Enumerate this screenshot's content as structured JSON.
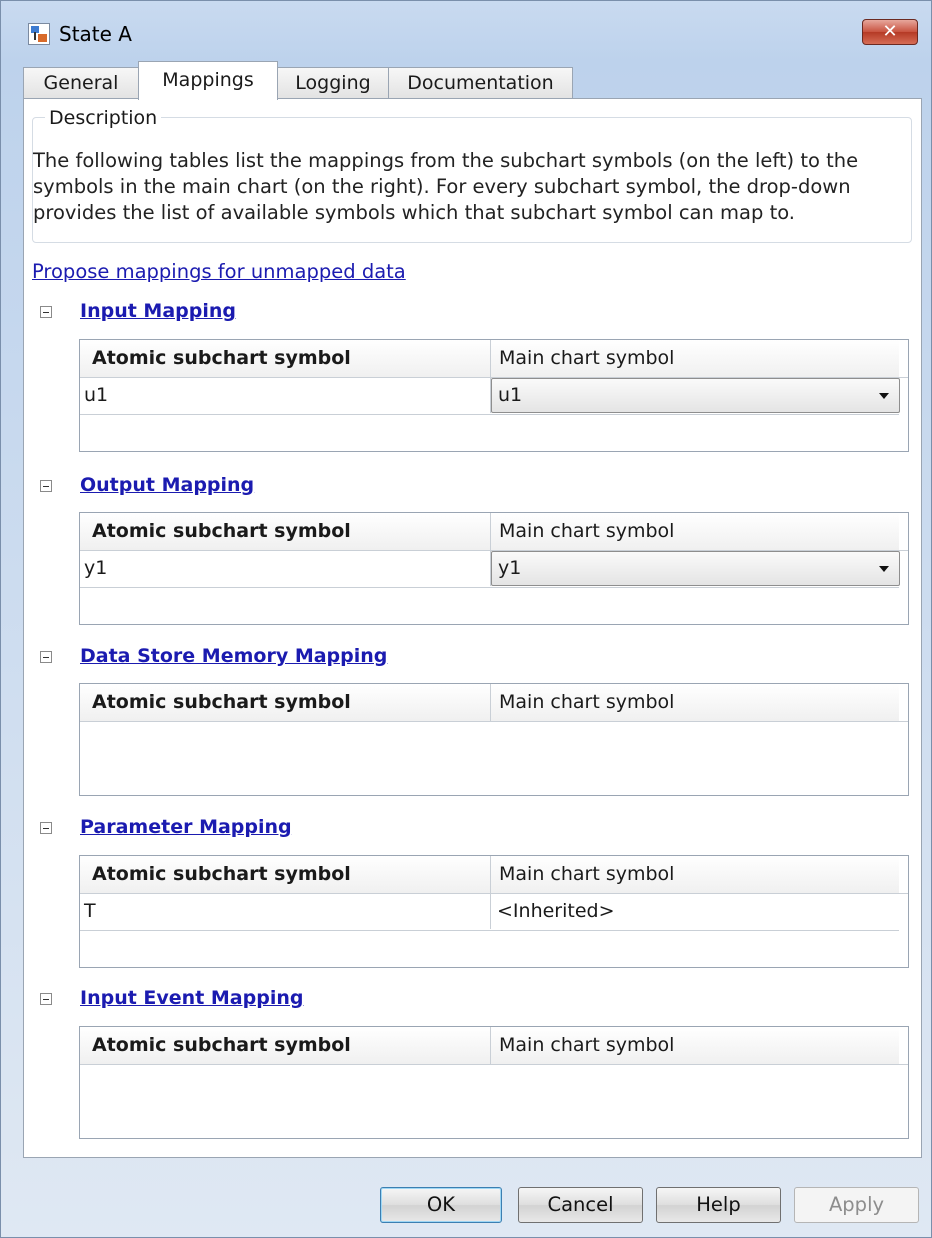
{
  "window": {
    "title": "State A"
  },
  "tabs": [
    {
      "label": "General"
    },
    {
      "label": "Mappings"
    },
    {
      "label": "Logging"
    },
    {
      "label": "Documentation"
    }
  ],
  "description": {
    "legend": "Description",
    "lines": [
      "The following tables list the mappings from the subchart symbols (on the left) to the",
      "symbols in the main chart (on the right). For every subchart symbol, the drop-down",
      "provides the list of available symbols which that subchart symbol can map to."
    ]
  },
  "propose_link": "Propose mappings for unmapped data",
  "columns": {
    "subchart": "Atomic subchart symbol",
    "main": "Main chart symbol"
  },
  "sections": {
    "input": {
      "title": "Input Mapping",
      "row": {
        "subchart": "u1",
        "main": "u1"
      }
    },
    "output": {
      "title": "Output Mapping",
      "row": {
        "subchart": "y1",
        "main": "y1"
      }
    },
    "data_store": {
      "title": "Data Store Memory Mapping"
    },
    "parameter": {
      "title": "Parameter Mapping",
      "row": {
        "subchart": "T",
        "main": "<Inherited>"
      }
    },
    "input_event": {
      "title": "Input Event Mapping"
    }
  },
  "buttons": {
    "ok": "OK",
    "cancel": "Cancel",
    "help": "Help",
    "apply": "Apply"
  },
  "close_glyph": "✕"
}
